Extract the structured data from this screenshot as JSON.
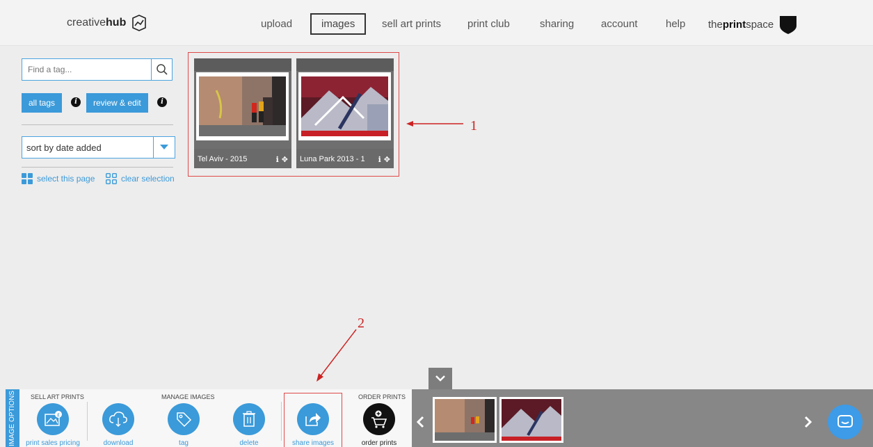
{
  "nav": {
    "logo_prefix": "creative",
    "logo_bold": "hub",
    "items": [
      "upload",
      "images",
      "sell art prints",
      "print club",
      "sharing",
      "account",
      "help"
    ],
    "active": "images",
    "right_logo_prefix": "the",
    "right_logo_bold": "print",
    "right_logo_suffix": "space"
  },
  "sidebar": {
    "search_placeholder": "Find a tag...",
    "all_tags": "all tags",
    "review_edit": "review & edit",
    "info_glyph": "i",
    "sort_label": "sort by date added",
    "select_page": "select this page",
    "clear_selection": "clear selection"
  },
  "images": [
    {
      "caption": "Tel Aviv - 2015"
    },
    {
      "caption": "Luna Park 2013 - 1"
    }
  ],
  "annotations": {
    "one": "1",
    "two": "2"
  },
  "toolbar": {
    "vertical_label": "IMAGE OPTIONS",
    "sell_section": "SELL ART PRINTS",
    "manage_section": "MANAGE IMAGES",
    "order_section": "ORDER PRINTS",
    "tools": {
      "pricing": "print sales pricing",
      "download": "download",
      "tag": "tag",
      "delete": "delete",
      "share": "share images",
      "order": "order prints"
    }
  },
  "colors": {
    "accent": "#3b9ad9",
    "annotation": "#e04848"
  }
}
